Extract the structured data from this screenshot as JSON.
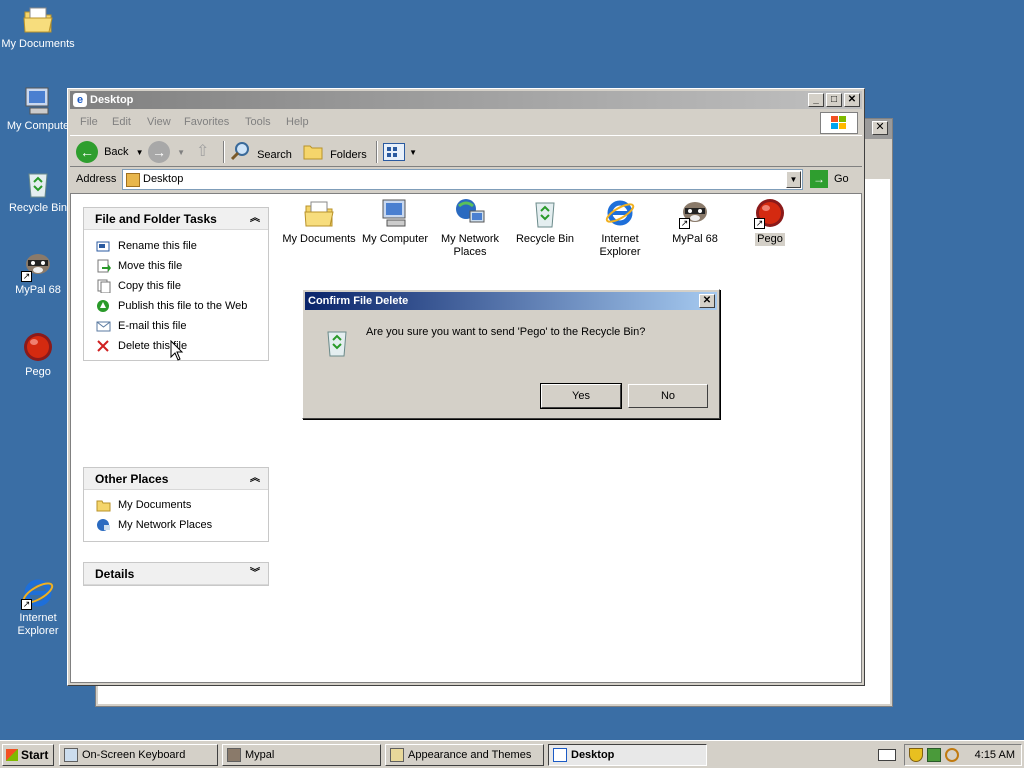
{
  "desktop_icons": [
    {
      "label": "My Documents"
    },
    {
      "label": "My Compute"
    },
    {
      "label": "Recycle Bin"
    },
    {
      "label": "MyPal 68"
    },
    {
      "label": "Pego"
    },
    {
      "label": "Internet Explorer"
    }
  ],
  "window": {
    "title": "Desktop",
    "menu": [
      "File",
      "Edit",
      "View",
      "Favorites",
      "Tools",
      "Help"
    ],
    "toolbar": {
      "back": "Back",
      "search": "Search",
      "folders": "Folders"
    },
    "address": {
      "label": "Address",
      "value": "Desktop",
      "go": "Go"
    }
  },
  "tasks": {
    "file_folder": {
      "title": "File and Folder Tasks",
      "items": [
        "Rename this file",
        "Move this file",
        "Copy this file",
        "Publish this file to the Web",
        "E-mail this file",
        "Delete this file"
      ]
    },
    "other_places": {
      "title": "Other Places",
      "items": [
        "My Documents",
        "My Network Places"
      ]
    },
    "details": {
      "title": "Details"
    }
  },
  "folder_icons": [
    {
      "label": "My Documents"
    },
    {
      "label": "My Computer"
    },
    {
      "label": "My Network Places"
    },
    {
      "label": "Recycle Bin"
    },
    {
      "label": "Internet Explorer"
    },
    {
      "label": "MyPal 68"
    },
    {
      "label": "Pego"
    }
  ],
  "dialog": {
    "title": "Confirm File Delete",
    "message": "Are you sure you want to send 'Pego' to the Recycle Bin?",
    "yes": "Yes",
    "no": "No"
  },
  "taskbar": {
    "start": "Start",
    "items": [
      "On-Screen Keyboard",
      "Mypal",
      "Appearance and Themes",
      "Desktop"
    ],
    "clock": "4:15 AM"
  },
  "colors": {
    "desktop": "#3a6ea5",
    "dialog_title": "#0a246a"
  }
}
